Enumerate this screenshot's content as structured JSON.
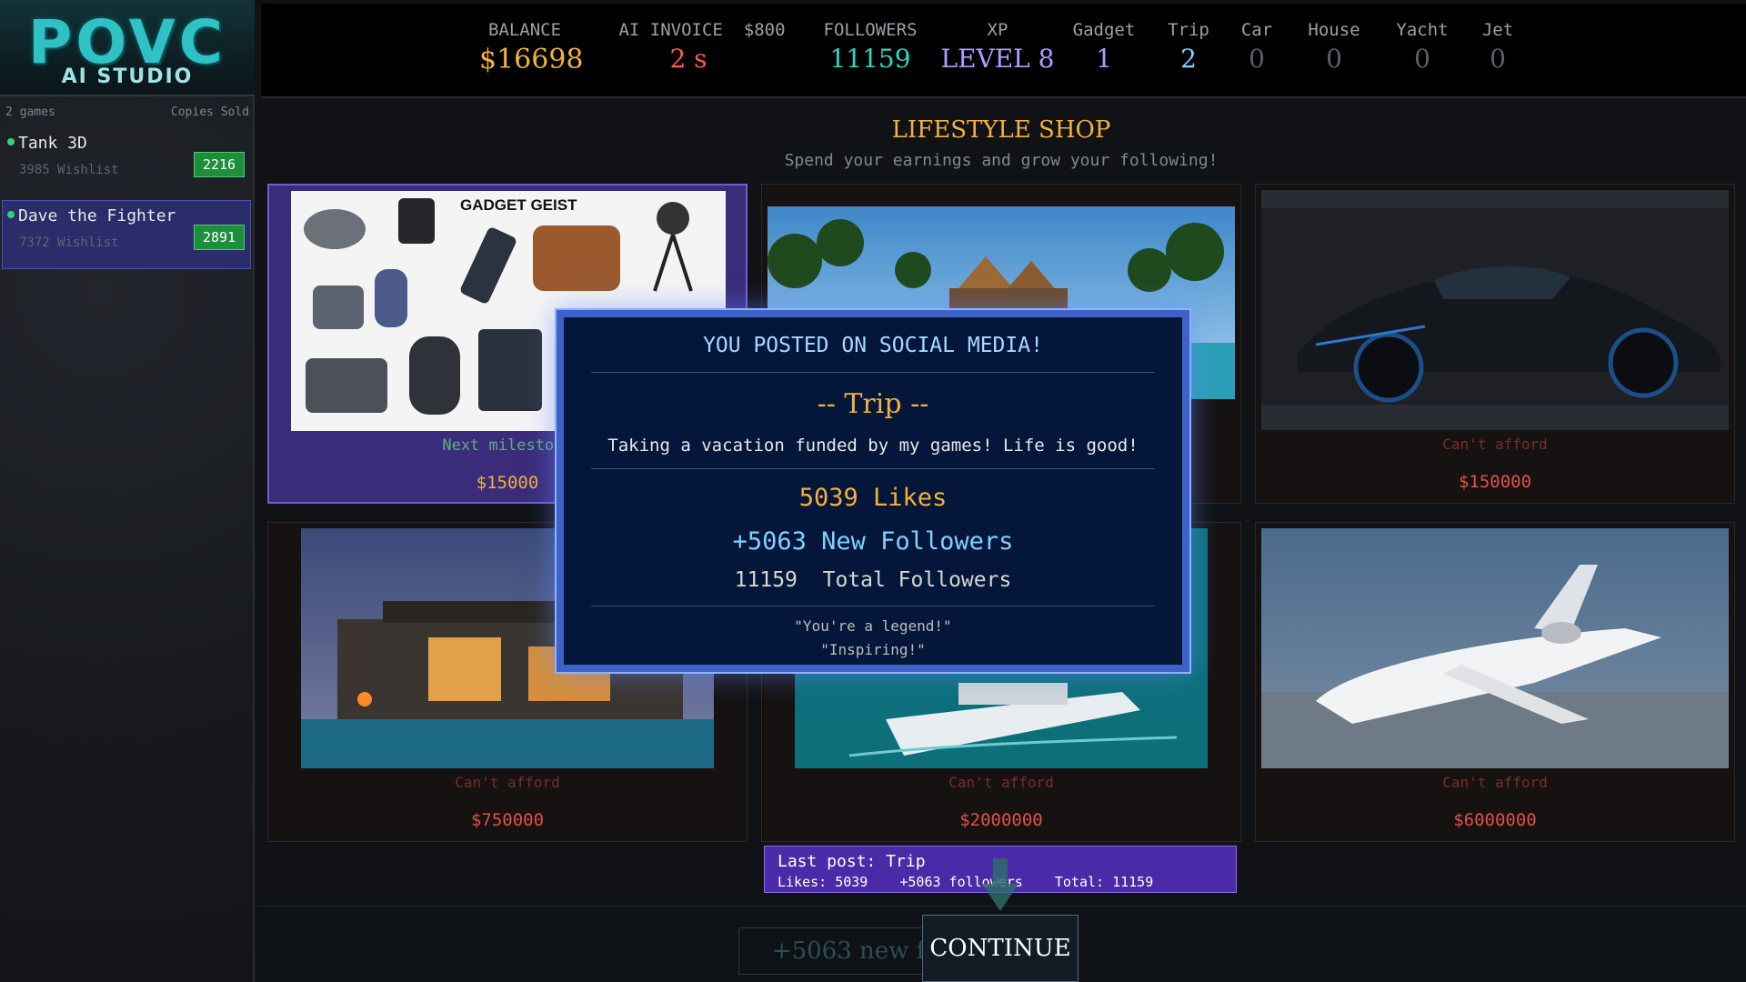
{
  "logo": {
    "main": "POVC",
    "sub": "AI STUDIO"
  },
  "sidebar": {
    "header_left": "2 games",
    "header_right": "Copies Sold",
    "games": [
      {
        "name": "Tank 3D",
        "wishlist": "3985 Wishlist",
        "copies": "2216",
        "selected": false
      },
      {
        "name": "Dave the Fighter",
        "wishlist": "7372 Wishlist",
        "copies": "2891",
        "selected": true
      }
    ]
  },
  "stats": {
    "balance": {
      "label": "BALANCE",
      "value": "$16698",
      "color": "#f2b13a"
    },
    "invoice": {
      "label": "AI INVOICE",
      "amount": "$800",
      "value": "2 s",
      "color": "#ff5b4a"
    },
    "followers": {
      "label": "FOLLOWERS",
      "value": "11159",
      "color": "#2ad9c5"
    },
    "xp": {
      "label": "XP",
      "value": "LEVEL 8",
      "color": "#b09cff"
    },
    "gadget": {
      "label": "Gadget",
      "value": "1",
      "color": "#b09cff"
    },
    "trip": {
      "label": "Trip",
      "value": "2",
      "color": "#7fd1ff"
    },
    "car": {
      "label": "Car",
      "value": "0",
      "color": "#5b6168"
    },
    "house": {
      "label": "House",
      "value": "0",
      "color": "#5b6168"
    },
    "yacht": {
      "label": "Yacht",
      "value": "0",
      "color": "#5b6168"
    },
    "jet": {
      "label": "Jet",
      "value": "0",
      "color": "#5b6168"
    }
  },
  "shop": {
    "title": "LIFESTYLE SHOP",
    "subtitle": "Spend your earnings and grow your following!",
    "items": [
      {
        "id": "gadget",
        "status": "Next milestone",
        "price": "$15000",
        "image": "gadget-collage",
        "brand": "GADGET GEIST",
        "affordable": true
      },
      {
        "id": "trip",
        "status": "",
        "price": "",
        "image": "beach-resort",
        "affordable": false
      },
      {
        "id": "car",
        "status": "Can't afford",
        "price": "$150000",
        "image": "sports-car",
        "affordable": false
      },
      {
        "id": "house",
        "status": "Can't afford",
        "price": "$750000",
        "image": "modern-house",
        "affordable": false
      },
      {
        "id": "yacht",
        "status": "Can't afford",
        "price": "$2000000",
        "image": "yacht",
        "affordable": false
      },
      {
        "id": "jet",
        "status": "Can't afford",
        "price": "$6000000",
        "image": "private-jet",
        "affordable": false
      }
    ]
  },
  "modal": {
    "title": "YOU POSTED ON SOCIAL MEDIA!",
    "item": "-- Trip --",
    "caption": "Taking a vacation funded by my games! Life is good!",
    "likes": "5039 Likes",
    "new_followers": "+5063 New Followers",
    "total_followers": "11159  Total Followers",
    "quotes": [
      "\"You're a legend!\"",
      "\"Inspiring!\""
    ]
  },
  "last_post": {
    "line1": "Last post: Trip",
    "likes": "Likes: 5039",
    "followers": "+5063 followers",
    "total": "Total: 11159"
  },
  "toast": "+5063 new follo",
  "continue_label": "CONTINUE"
}
